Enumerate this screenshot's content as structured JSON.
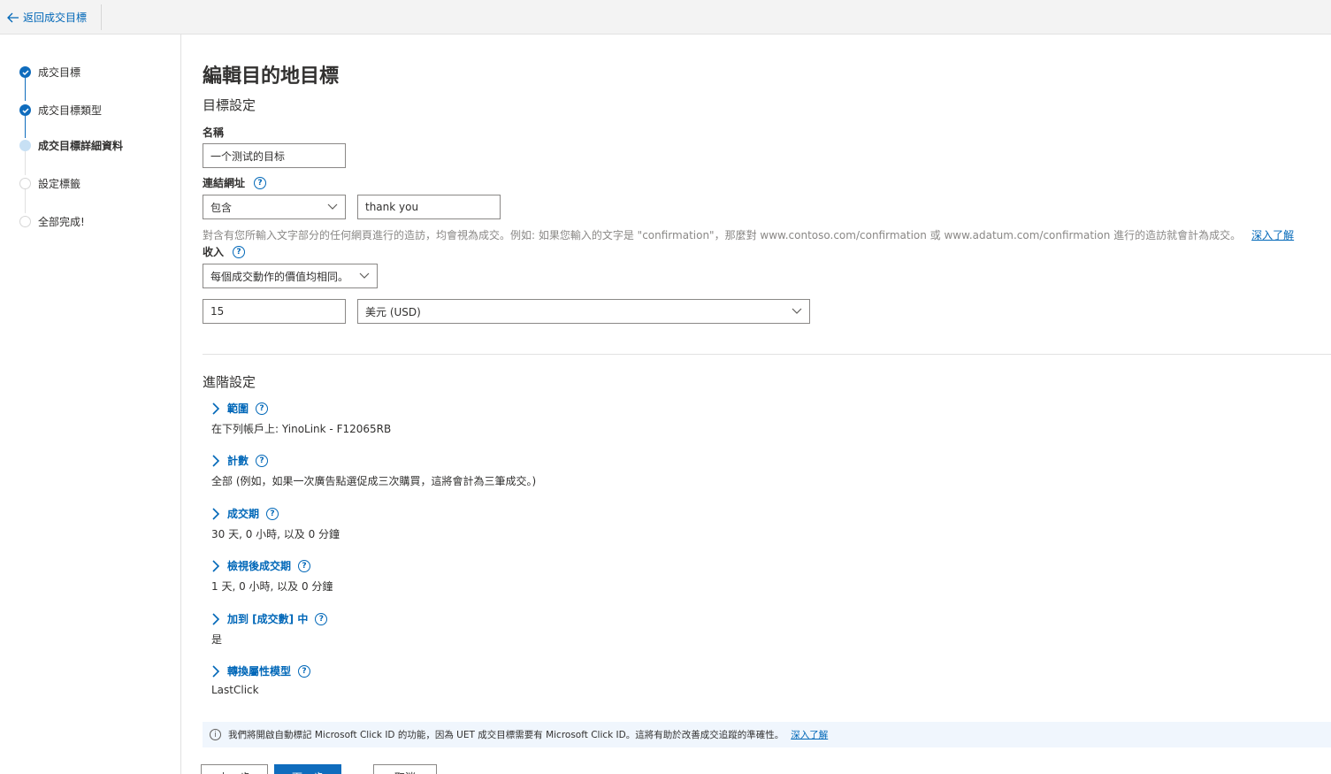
{
  "topbar": {
    "back_label": "返回成交目標"
  },
  "steps": [
    {
      "label": "成交目標",
      "state": "done"
    },
    {
      "label": "成交目標類型",
      "state": "done"
    },
    {
      "label": "成交目標詳細資料",
      "state": "current"
    },
    {
      "label": "設定標籤",
      "state": "todo"
    },
    {
      "label": "全部完成!",
      "state": "todo"
    }
  ],
  "page": {
    "title": "編輯目的地目標",
    "goal_settings": "目標設定",
    "advanced_settings": "進階設定"
  },
  "form": {
    "name_label": "名稱",
    "name_value": "一个测试的目标",
    "url_label": "連結網址",
    "url_operator": "包含",
    "url_value": "thank you",
    "url_hint": "對含有您所輸入文字部分的任何網頁進行的造訪，均會視為成交。例如: 如果您輸入的文字是 \"confirmation\"，那麼對 www.contoso.com/confirmation 或 www.adatum.com/confirmation 進行的造訪就會計為成交。",
    "url_hint_link": "深入了解",
    "revenue_label": "收入",
    "revenue_type": "每個成交動作的價值均相同。",
    "revenue_value": "15",
    "currency": "美元 (USD)"
  },
  "advanced": [
    {
      "label": "範圍",
      "value": "在下列帳戶上: YinoLink - F12065RB"
    },
    {
      "label": "計數",
      "value": "全部 (例如，如果一次廣告點選促成三次購買，這將會計為三筆成交。)"
    },
    {
      "label": "成交期",
      "value": "30 天, 0 小時, 以及 0 分鐘"
    },
    {
      "label": "檢視後成交期",
      "value": "1 天, 0 小時, 以及 0 分鐘"
    },
    {
      "label": "加到 [成交數] 中",
      "value": "是"
    },
    {
      "label": "轉換屬性模型",
      "value": "LastClick"
    }
  ],
  "info_bar": {
    "text": "我們將開啟自動標記 Microsoft Click ID 的功能，因為 UET 成交目標需要有 Microsoft Click ID。這將有助於改善成交追蹤的準確性。",
    "link": "深入了解"
  },
  "footer": {
    "back": "上一步",
    "next": "下一步",
    "cancel": "取消"
  },
  "colors": {
    "accent": "#0f6cbd",
    "link": "#0067b8"
  }
}
